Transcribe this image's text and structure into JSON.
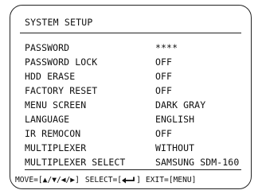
{
  "title": "SYSTEM SETUP",
  "menu": [
    {
      "label": "PASSWORD",
      "value": "****"
    },
    {
      "label": "PASSWORD LOCK",
      "value": "OFF"
    },
    {
      "label": "HDD ERASE",
      "value": "OFF"
    },
    {
      "label": "FACTORY RESET",
      "value": "OFF"
    },
    {
      "label": "MENU SCREEN",
      "value": "DARK GRAY"
    },
    {
      "label": "LANGUAGE",
      "value": "ENGLISH"
    },
    {
      "label": "IR REMOCON",
      "value": "OFF"
    },
    {
      "label": "MULTIPLEXER",
      "value": "WITHOUT"
    },
    {
      "label": "MULTIPLEXER SELECT",
      "value": "SAMSUNG SDM-160"
    }
  ],
  "footer": {
    "move_prefix": "MOVE=[",
    "move_keys": "▲/▼/◀/▶",
    "move_suffix": "]",
    "select_prefix": "SELECT=[",
    "select_suffix": "]",
    "exit": "EXIT=[MENU]"
  }
}
